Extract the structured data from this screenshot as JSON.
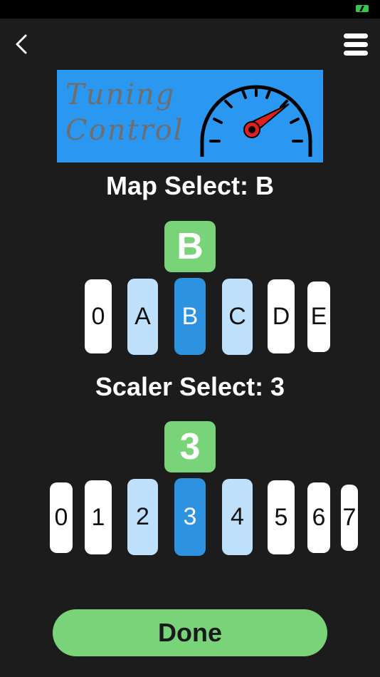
{
  "logo": {
    "line1": "Tuning",
    "line2": "Control",
    "bg_color": "#2a97f0"
  },
  "map_select": {
    "title": "Map Select: B",
    "current": "B",
    "items": [
      "0",
      "A",
      "B",
      "C",
      "D",
      "E"
    ]
  },
  "scaler_select": {
    "title": "Scaler Select: 3",
    "current": "3",
    "items": [
      "0",
      "1",
      "2",
      "3",
      "4",
      "5",
      "6",
      "7"
    ]
  },
  "done_label": "Done",
  "colors": {
    "background": "#1c1c1c",
    "badge_green": "#78d379",
    "selected_blue": "#2d92e0",
    "neighbor_blue": "#bfe0fb"
  }
}
